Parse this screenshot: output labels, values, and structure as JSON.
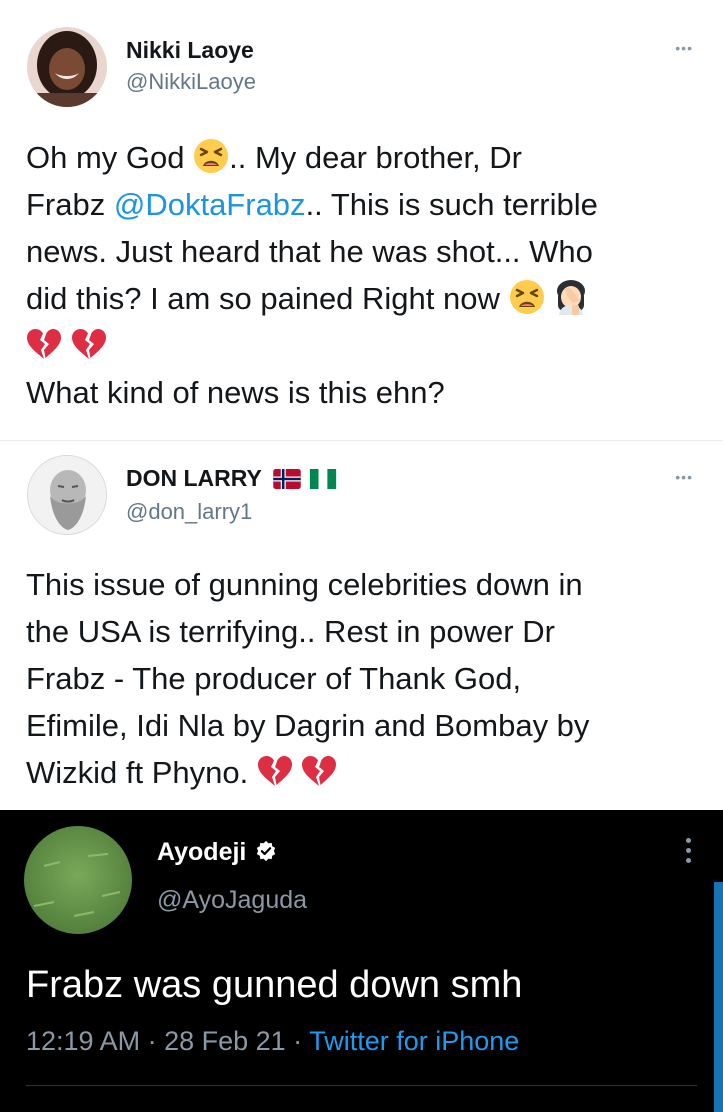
{
  "tweets": [
    {
      "name": "Nikki Laoye",
      "handle": "@NikkiLaoye",
      "text": {
        "l1a": "Oh my God ",
        "l1b": ".. My dear brother, Dr",
        "l2a": "Frabz ",
        "l2mention": "@DoktaFrabz",
        "l2b": ".. This is such terrible",
        "l3": "news. Just heard that he was shot... Who",
        "l4": "did this? I am so pained Right now ",
        "l6": "What kind of news is this ehn?"
      },
      "more_label": "•••"
    },
    {
      "name": "DON LARRY",
      "handle": "@don_larry1",
      "text": {
        "l1": "This issue of gunning celebrities down in",
        "l2": "the USA is terrifying.. Rest in power Dr",
        "l3": "Frabz - The producer of Thank God,",
        "l4": "Efimile, Idi Nla by Dagrin and Bombay by",
        "l5": "Wizkid ft Phyno. "
      },
      "more_label": "•••"
    },
    {
      "name": "Ayodeji",
      "handle": "@AyoJaguda",
      "text": "Frabz was gunned down smh",
      "time": "12:19 AM",
      "date": "28 Feb 21",
      "source": "Twitter for iPhone",
      "sep": " · "
    }
  ],
  "colors": {
    "mention": "#1b95e0",
    "verified": "#ffffff",
    "dark_bg": "#000000"
  },
  "icons": [
    "tired-face-emoji",
    "facepalm-emoji",
    "broken-heart-emoji",
    "norway-flag-icon",
    "nigeria-flag-icon",
    "verified-badge-icon",
    "more-options-icon"
  ]
}
